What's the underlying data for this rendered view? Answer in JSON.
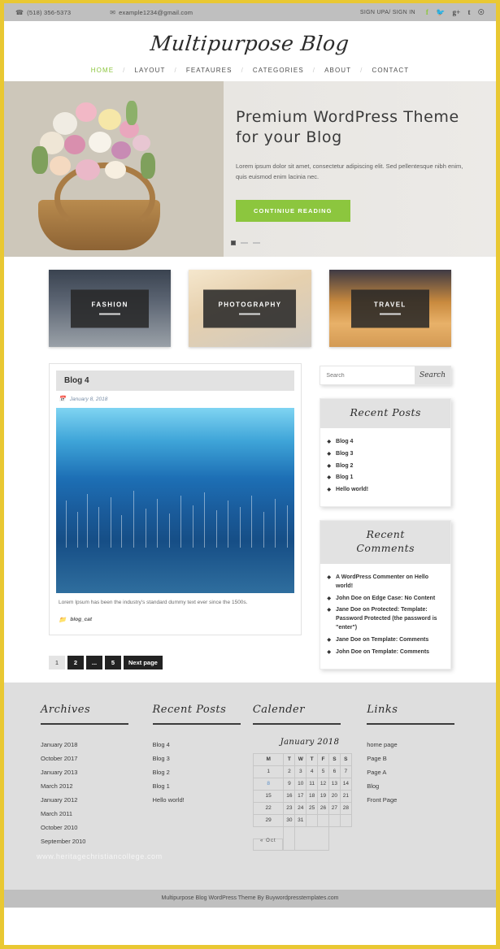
{
  "topbar": {
    "phone": "(518) 356-5373",
    "phone_icon": "phone-icon",
    "email": "example1234@gmail.com",
    "email_icon": "envelope-icon",
    "signin": "SIGN UPA/ SIGN IN",
    "social": [
      {
        "name": "facebook-icon",
        "glyph": "f",
        "color": "#8cc63e"
      },
      {
        "name": "twitter-icon",
        "glyph": "ᵛ",
        "color": "#4a4a4a"
      },
      {
        "name": "googleplus-icon",
        "glyph": "g+",
        "color": "#4a4a4a"
      },
      {
        "name": "tumblr-icon",
        "glyph": "t",
        "color": "#4a4a4a"
      },
      {
        "name": "pinterest-icon",
        "glyph": "ⓟ",
        "color": "#4a4a4a"
      }
    ]
  },
  "header": {
    "logo": "Multipurpose Blog",
    "nav": [
      {
        "label": "HOME",
        "active": true
      },
      {
        "label": "LAYOUT",
        "active": false
      },
      {
        "label": "FEATAURES",
        "active": false
      },
      {
        "label": "CATEGORIES",
        "active": false
      },
      {
        "label": "ABOUT",
        "active": false
      },
      {
        "label": "CONTACT",
        "active": false
      }
    ],
    "nav_separator": "/"
  },
  "hero": {
    "title_line1": "Premium WordPress Theme",
    "title_line2": "for your Blog",
    "subtitle": "Lorem ipsum dolor sit amet, consectetur adipiscing elit. Sed pellentesque nibh enim, quis euismod enim lacinia nec.",
    "button": "CONTINIUE READING",
    "button_color": "#8cc63e",
    "slide_count": 3,
    "active_slide": 1
  },
  "categories": [
    {
      "label": "FASHION",
      "image": "two-children-on-street"
    },
    {
      "label": "PHOTOGRAPHY",
      "image": "woman-holding-camera"
    },
    {
      "label": "TRAVEL",
      "image": "yellow-car-in-desert"
    }
  ],
  "post": {
    "title": "Blog 4",
    "date": "January 8, 2018",
    "date_icon": "calendar-icon",
    "image": "blue-marina-boats",
    "excerpt": "Lorem Ipsum has been the industry's standard dummy text ever since the 1500s.",
    "category": "blog_cat",
    "category_icon": "folder-icon"
  },
  "pagination": [
    {
      "label": "1",
      "current": true
    },
    {
      "label": "2",
      "current": false
    },
    {
      "label": "...",
      "current": false
    },
    {
      "label": "5",
      "current": false
    },
    {
      "label": "Next page",
      "current": false
    }
  ],
  "sidebar": {
    "search": {
      "placeholder": "Search",
      "button": "Search",
      "value": ""
    },
    "recent_posts": {
      "title": "Recent Posts",
      "items": [
        "Blog 4",
        "Blog 3",
        "Blog 2",
        "Blog 1",
        "Hello world!"
      ]
    },
    "recent_comments": {
      "title_line1": "Recent",
      "title_line2": "Comments",
      "items": [
        "A WordPress Commenter on Hello world!",
        "John Doe on Edge Case: No Content",
        "Jane Doe on Protected: Template: Password Protected (the password is \"enter\")",
        "Jane Doe on Template: Comments",
        "John Doe on Template: Comments"
      ]
    }
  },
  "footer": {
    "archives": {
      "title": "Archives",
      "items": [
        "January 2018",
        "October 2017",
        "January 2013",
        "March 2012",
        "January 2012",
        "March 2011",
        "October 2010",
        "September 2010"
      ]
    },
    "recent_posts": {
      "title": "Recent Posts",
      "items": [
        "Blog 4",
        "Blog 3",
        "Blog 2",
        "Blog 1",
        "Hello world!"
      ]
    },
    "calendar": {
      "title": "Calender",
      "month": "January 2018",
      "weekdays": [
        "M",
        "T",
        "W",
        "T",
        "F",
        "S",
        "S"
      ],
      "weeks": [
        [
          "1",
          "2",
          "3",
          "4",
          "5",
          "6",
          "7"
        ],
        [
          "8",
          "9",
          "10",
          "11",
          "12",
          "13",
          "14"
        ],
        [
          "15",
          "16",
          "17",
          "18",
          "19",
          "20",
          "21"
        ],
        [
          "22",
          "23",
          "24",
          "25",
          "26",
          "27",
          "28"
        ],
        [
          "29",
          "30",
          "31",
          "",
          "",
          "",
          ""
        ]
      ],
      "today": "8",
      "prev_label": "« Oct"
    },
    "links": {
      "title": "Links",
      "items": [
        "home page",
        "Page B",
        "Page A",
        "Blog",
        "Front Page"
      ]
    },
    "watermark": "www.heritagechristiancollege.com"
  },
  "bottombar": {
    "text": "Multipurpose Blog WordPress Theme By Buywordpresstemplates.com"
  }
}
